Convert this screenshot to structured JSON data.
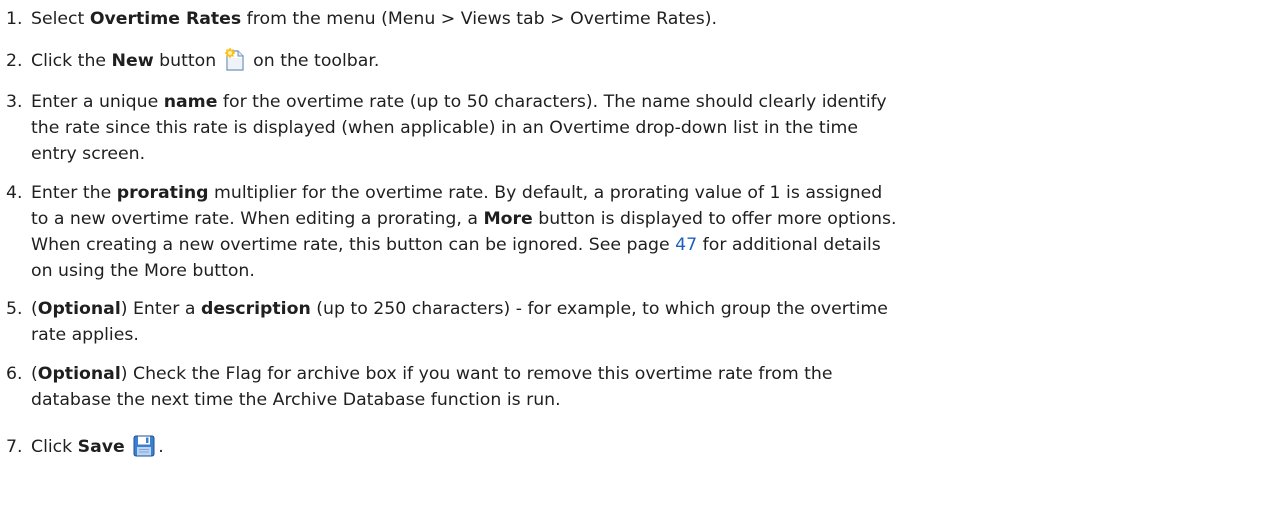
{
  "steps": [
    {
      "num": "1.",
      "t1": "Select ",
      "b1": "Overtime Rates",
      "t2": " from the menu (Menu > Views tab > Overtime Rates)."
    },
    {
      "num": "2.",
      "t1": "Click the ",
      "b1": "New",
      "t2": " button",
      "icon": "new-document-icon",
      "t3": " on the toolbar."
    },
    {
      "num": "3.",
      "t1": "Enter a unique ",
      "b1": "name",
      "t2": " for the overtime rate (up to 50 characters). The name should clearly identify",
      "l2": "the rate since this rate is displayed (when applicable) in an Overtime drop-down list in the time",
      "l3": "entry screen."
    },
    {
      "num": "4.",
      "t1": "Enter the ",
      "b1": "prorating",
      "t2": " multiplier for the overtime rate. By default, a prorating value of 1 is assigned",
      "l2a": "to a new overtime rate. When editing a prorating, a ",
      "l2b": "More",
      "l2c": " button is displayed to offer more options.",
      "l3": "When creating a new overtime rate, this button can be ignored. See page ",
      "page_link": "47",
      "l3b": " for additional details",
      "l4": "on using the More button."
    },
    {
      "num": "5.",
      "t1": "(",
      "b1": "Optional",
      "t2": ") Enter a ",
      "b2": "description",
      "t3": " (up to 250 characters) - for example, to which group the overtime",
      "l2": "rate applies."
    },
    {
      "num": "6.",
      "t1": "(",
      "b1": "Optional",
      "t2": ") Check the Flag for archive box if you want to remove this overtime rate from the",
      "l2": "database the next time the Archive Database function is run."
    },
    {
      "num": "7.",
      "t1": "Click ",
      "b1": "Save",
      "icon": "save-disk-icon",
      "t2": "."
    }
  ]
}
